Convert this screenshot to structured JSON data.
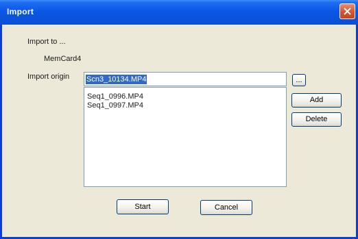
{
  "window": {
    "title": "Import",
    "close_icon": "close-icon"
  },
  "form": {
    "import_to_label": "Import to ...",
    "destination": "MemCard4",
    "import_origin_label": "Import origin",
    "origin_value": "Scn3_10134.MP4",
    "browse_label": "...",
    "files": [
      "Seq1_0996.MP4",
      "Seq1_0997.MP4"
    ]
  },
  "buttons": {
    "add": "Add",
    "delete": "Delete",
    "start": "Start",
    "cancel": "Cancel"
  },
  "colors": {
    "titlebar": "#0a58e6",
    "selection": "#316ac5",
    "close": "#d6542c",
    "dialog_bg": "#ece9d8"
  }
}
